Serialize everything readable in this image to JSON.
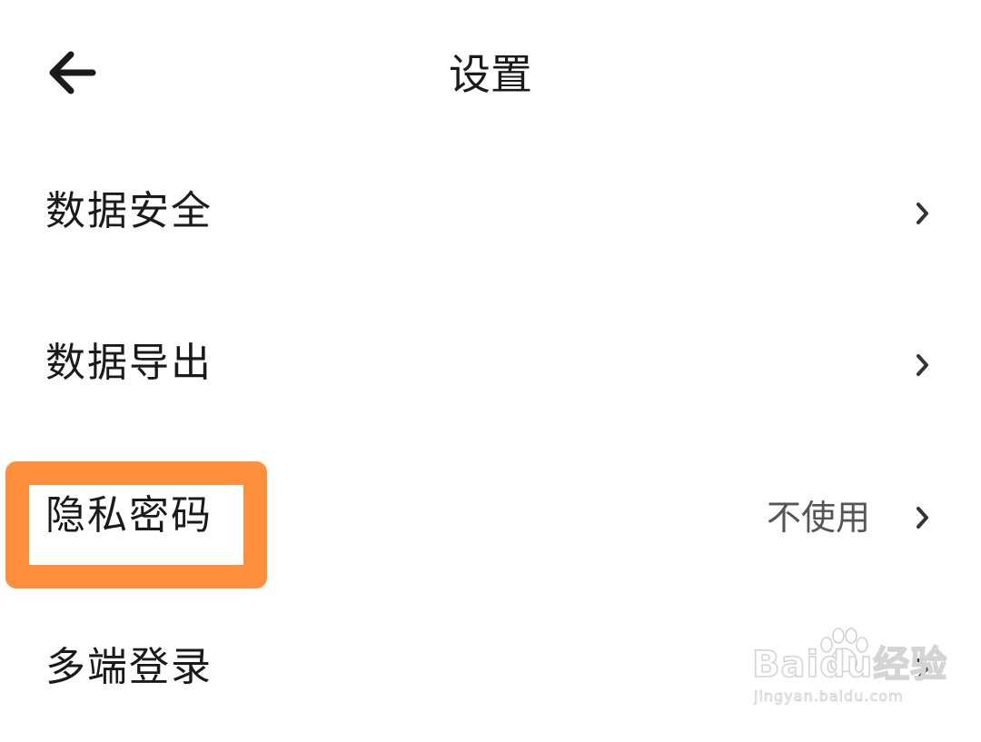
{
  "header": {
    "title": "设置",
    "back_icon": "arrow-left-icon"
  },
  "settings": {
    "items": [
      {
        "label": "数据安全",
        "value": "",
        "icon": "chevron-right-icon"
      },
      {
        "label": "数据导出",
        "value": "",
        "icon": "chevron-right-icon"
      },
      {
        "label": "隐私密码",
        "value": "不使用",
        "icon": "chevron-right-icon"
      },
      {
        "label": "多端登录",
        "value": "",
        "icon": "chevron-right-icon"
      }
    ]
  },
  "annotation": {
    "highlight_color": "#ff8f3c",
    "highlighted_item": "隐私密码"
  },
  "watermark": {
    "brand": "Baidu经验",
    "url": "jingyan.baidu.com",
    "icon": "baidu-paw-icon"
  }
}
